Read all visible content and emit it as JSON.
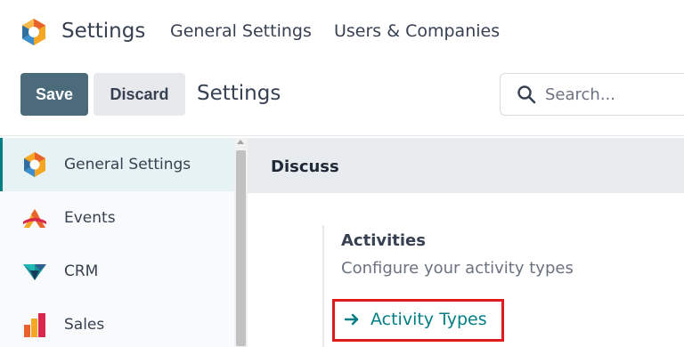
{
  "app": {
    "name": "Settings"
  },
  "navbar": {
    "items": [
      {
        "label": "General Settings"
      },
      {
        "label": "Users & Companies"
      }
    ]
  },
  "control_panel": {
    "save_label": "Save",
    "discard_label": "Discard",
    "breadcrumb": "Settings",
    "search_placeholder": "Search..."
  },
  "sidebar": {
    "items": [
      {
        "label": "General Settings",
        "icon": "general-settings-icon",
        "active": true
      },
      {
        "label": "Events",
        "icon": "events-icon",
        "active": false
      },
      {
        "label": "CRM",
        "icon": "crm-icon",
        "active": false
      },
      {
        "label": "Sales",
        "icon": "sales-icon",
        "active": false
      }
    ]
  },
  "main": {
    "section_title": "Discuss",
    "setting": {
      "title": "Activities",
      "description": "Configure your activity types",
      "link_label": "Activity Types"
    }
  },
  "colors": {
    "accent": "#017e84",
    "save_button": "#4b6b7b",
    "highlight": "#e01b1b"
  }
}
